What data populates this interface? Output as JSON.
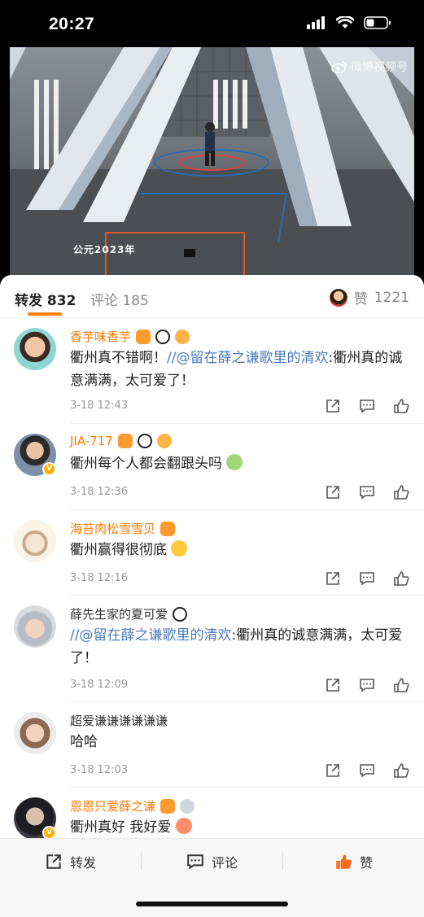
{
  "status": {
    "time": "20:27"
  },
  "video": {
    "caption": "公元2023年",
    "watermark": "微博视频号"
  },
  "tabs": {
    "reposts_label": "转发",
    "reposts_count": "832",
    "comments_label": "评论",
    "comments_count": "185"
  },
  "likes": {
    "label": "赞",
    "count": "1221"
  },
  "comments": [
    {
      "name": "香芋味香芋",
      "text_plain": "衢州真不错啊！",
      "mention": "//@留在薛之谦歌里的清欢",
      "text_after": ":衢州真的诚意满满，太可爱了！",
      "time": "3-18 12:43"
    },
    {
      "name": "JIA-717",
      "text_plain": "衢州每个人都会翻跟头吗",
      "time": "3-18 12:36"
    },
    {
      "name": "海苔肉松雪雪贝",
      "text_plain": "衢州赢得很彻底",
      "time": "3-18 12:16"
    },
    {
      "name": "薛先生家的夏可爱",
      "mention": "//@留在薛之谦歌里的清欢",
      "text_after": ":衢州真的诚意满满，太可爱了！",
      "time": "3-18 12:09"
    },
    {
      "name": "超爱谦谦谦谦谦谦",
      "text_plain": "哈哈",
      "time": "3-18 12:03"
    },
    {
      "name": "恩恩只爱薛之谦",
      "text_plain": "衢州真好 我好爱",
      "time": ""
    }
  ],
  "bottom_bar": {
    "repost": "转发",
    "comment": "评论",
    "like": "赞"
  },
  "colors": {
    "accent": "#ff8200",
    "mention": "#4a7bbd",
    "vip_name": "#ff7a00"
  }
}
